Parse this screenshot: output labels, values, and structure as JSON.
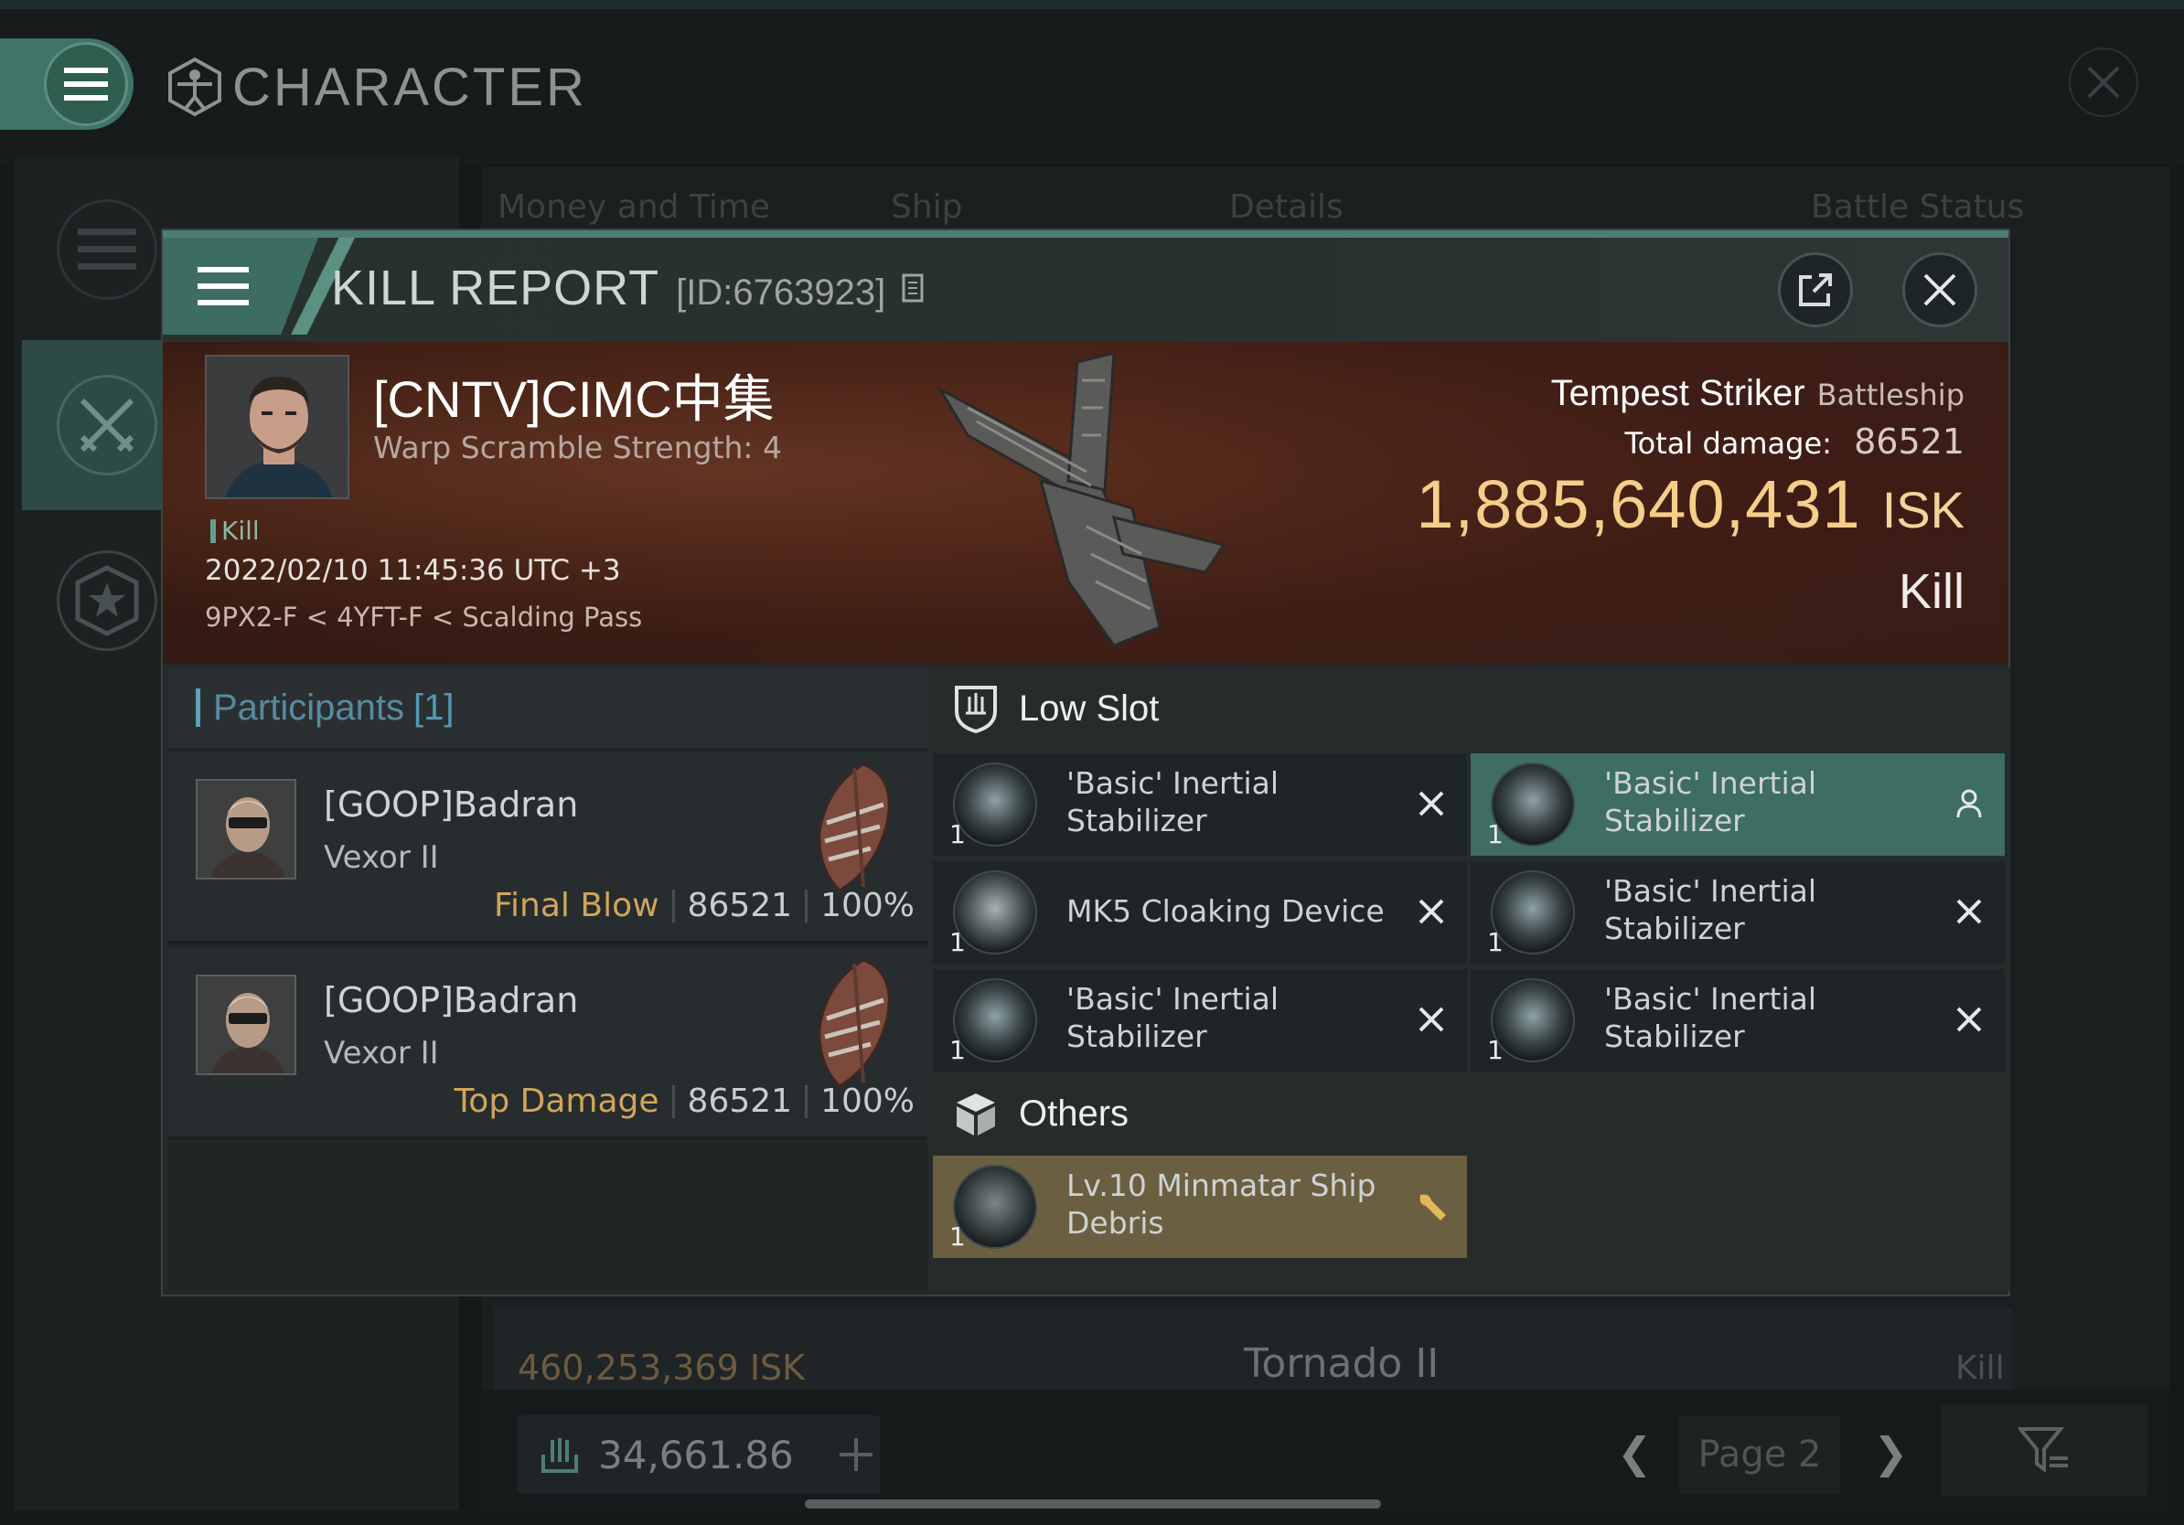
{
  "app": {
    "title": "CHARACTER"
  },
  "background": {
    "tabs": [
      "Money and Time",
      "Ship",
      "Details",
      "Battle Status"
    ],
    "row": {
      "isk": "460,253,369  ISK",
      "ship": "Tornado II",
      "status": "Kill"
    },
    "footer": {
      "wallet": "34,661.86",
      "page": "Page 2"
    }
  },
  "report": {
    "title": "KILL REPORT",
    "id": "[ID:6763923]",
    "victim": {
      "name": "[CNTV]CIMC中集",
      "subtitle": "Warp Scramble Strength: 4",
      "tag": "Kill",
      "time": "2022/02/10 11:45:36 UTC +3",
      "location": "9PX2-F < 4YFT-F < Scalding Pass"
    },
    "ship": {
      "name": "Tempest Striker",
      "class": "Battleship",
      "damage_label": "Total damage:",
      "damage": "86521",
      "isk_value": "1,885,640,431",
      "isk_unit": "ISK",
      "result": "Kill"
    },
    "participants": {
      "label": "Participants",
      "count": "[1]",
      "rows": [
        {
          "name": "[GOOP]Badran",
          "ship": "Vexor II",
          "tag": "Final Blow",
          "damage": "86521",
          "percent": "100%"
        },
        {
          "name": "[GOOP]Badran",
          "ship": "Vexor II",
          "tag": "Top Damage",
          "damage": "86521",
          "percent": "100%"
        }
      ]
    },
    "low_slot": {
      "label": "Low Slot",
      "items": [
        {
          "qty": "1",
          "name": "'Basic' Inertial Stabilizer",
          "status": "destroyed"
        },
        {
          "qty": "1",
          "name": "'Basic' Inertial Stabilizer",
          "status": "dropped"
        },
        {
          "qty": "1",
          "name": "MK5 Cloaking Device",
          "status": "destroyed"
        },
        {
          "qty": "1",
          "name": "'Basic' Inertial Stabilizer",
          "status": "destroyed"
        },
        {
          "qty": "1",
          "name": "'Basic' Inertial Stabilizer",
          "status": "destroyed"
        },
        {
          "qty": "1",
          "name": "'Basic' Inertial Stabilizer",
          "status": "destroyed"
        }
      ]
    },
    "others": {
      "label": "Others",
      "items": [
        {
          "qty": "1",
          "name": "Lv.10 Minmatar Ship Debris",
          "status": "salvage"
        }
      ]
    }
  },
  "colors": {
    "accent": "#3d6c62",
    "isk": "#f5cf8a",
    "tag_gold": "#d0a65a",
    "participants_blue": "#4f9ab5"
  },
  "icons": [
    "menu-icon",
    "vitruvian-icon",
    "close-icon",
    "swords-icon",
    "star-icon",
    "copy-icon",
    "share-icon",
    "shield-icon",
    "box-icon",
    "x-icon",
    "person-icon",
    "wrench-icon",
    "filter-icon",
    "plus-icon",
    "chevron-left-icon",
    "chevron-right-icon"
  ]
}
